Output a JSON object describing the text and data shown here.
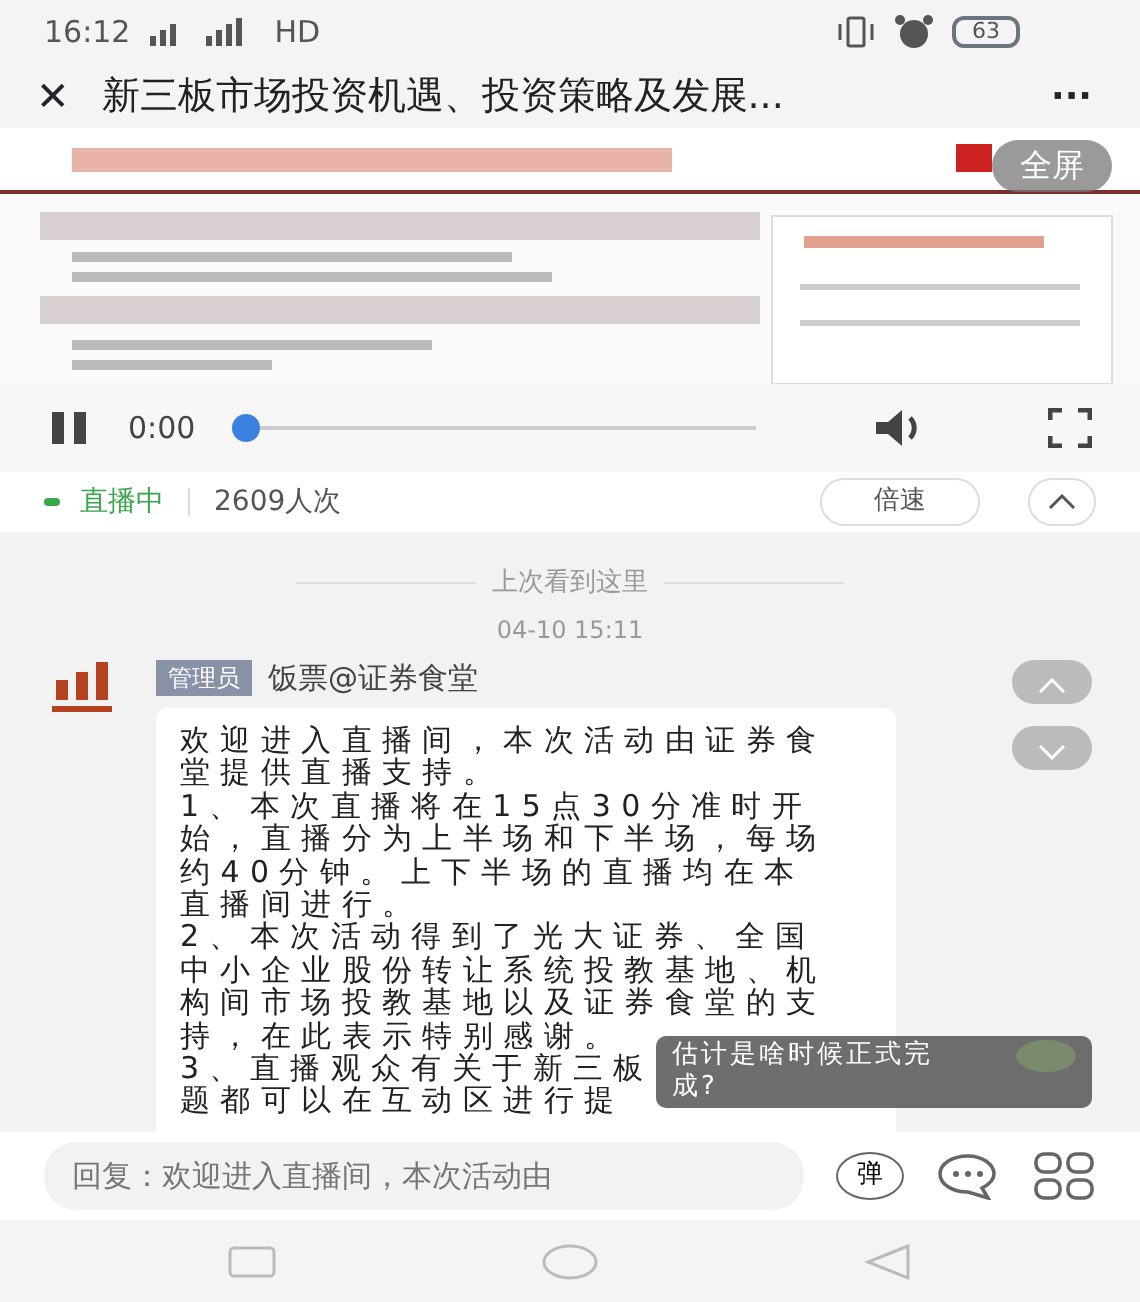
{
  "status_bar": {
    "time": "16:12",
    "network": "HD",
    "battery": "63"
  },
  "title_bar": {
    "title": "新三板市场投资机遇、投资策略及发展...",
    "close": "✕",
    "more": "···"
  },
  "video": {
    "kind": "picture",
    "fullscreen_label": "全屏",
    "playing": true,
    "time": "0:00",
    "level": 0.0
  },
  "live_bar": {
    "status": "直播中",
    "viewers": "2609人次",
    "speed_button": "倍速"
  },
  "chat": {
    "divider": "上次看到这里",
    "timestamp": "04-10 15:11",
    "messages": [
      {
        "role": "管理员",
        "author": "饭票@证券食堂",
        "lines": [
          "欢迎进入直播间，本次活动由证券食",
          "堂提供直播支持。",
          "1、本次直播将在15点30分准时开",
          "始，直播分为上半场和下半场，每场",
          "约40分钟。上下半场的直播均在本",
          "直播间进行。",
          "2、本次活动得到了光大证券、全国",
          "中小企业股份转让系统投教基地、机",
          "构间市场投教基地以及证券食堂的支",
          "持，在此表示特别感谢。",
          "3、直播观众有关于新三板",
          "题都可以在互动区进行提"
        ]
      }
    ],
    "floating_comment": "估计是啥时候正式完成?"
  },
  "reply_bar": {
    "placeholder": "回复：欢迎进入直播间，本次活动由",
    "danmaku_button": "弹"
  }
}
